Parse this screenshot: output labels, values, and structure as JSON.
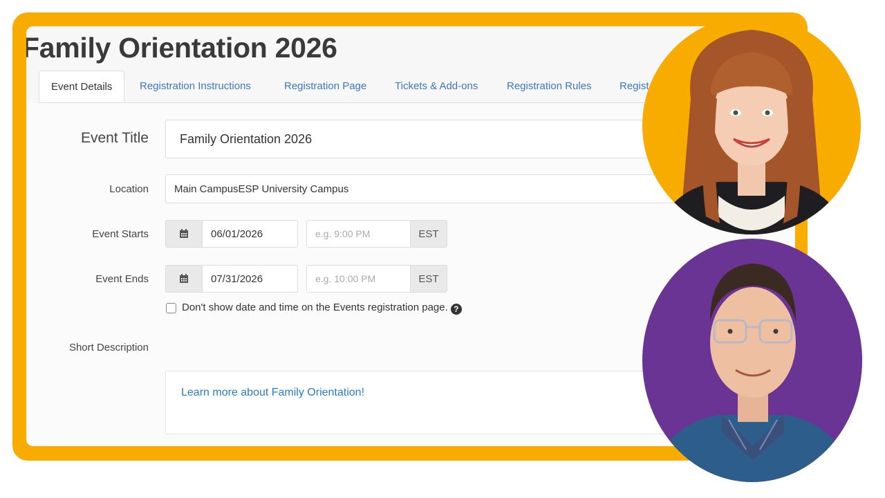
{
  "page_title": "Family Orientation 2026",
  "tabs": [
    {
      "label": "Event Details",
      "active": true
    },
    {
      "label": "Registration Instructions"
    },
    {
      "label": "Registration Page"
    },
    {
      "label": "Tickets & Add-ons"
    },
    {
      "label": "Registration Rules"
    },
    {
      "label": "Regist"
    }
  ],
  "form": {
    "event_title_label": "Event Title",
    "event_title_value": "Family Orientation 2026",
    "location_label": "Location",
    "location_value": "Main CampusESP University Campus",
    "event_starts_label": "Event Starts",
    "event_starts_date": "06/01/2026",
    "event_starts_time_placeholder": "e.g. 9:00 PM",
    "event_starts_tz": "EST",
    "event_ends_label": "Event Ends",
    "event_ends_date": "07/31/2026",
    "event_ends_time_placeholder": "e.g. 10:00 PM",
    "event_ends_tz": "EST",
    "hide_datetime_label": "Don't show date and time on the Events registration page.",
    "short_description_label": "Short Description",
    "description_text": "Learn more about Family Orientation!"
  },
  "toolbar_icons": [
    "bold-icon",
    "italic-icon",
    "underline-icon",
    "link-icon",
    "ordered-list-icon",
    "bullet-list-icon",
    "indent-icon",
    "outdent-icon",
    "table-icon",
    "emoji-icon",
    "undo-icon"
  ],
  "colors": {
    "frame": "#f8ac00",
    "avatar_top_bg": "#f8ac00",
    "avatar_bottom_bg": "#6a3494",
    "link": "#2b7bc3"
  }
}
